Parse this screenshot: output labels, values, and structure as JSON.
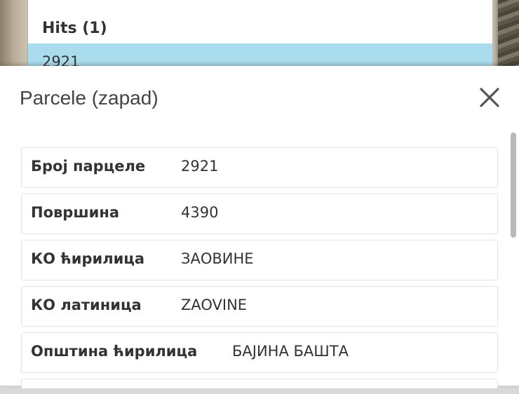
{
  "hits": {
    "title": "Hits (1)",
    "rows": [
      {
        "label": "2921"
      }
    ]
  },
  "panel": {
    "title": "Parcele (zapad)",
    "close_icon": "close-icon"
  },
  "attributes": [
    {
      "label": "Број парцеле",
      "value": "2921"
    },
    {
      "label": "Површина",
      "value": "4390"
    },
    {
      "label": "КО ћирилица",
      "value": "ЗАОВИНЕ"
    },
    {
      "label": "КО латиница",
      "value": "ZAOVINE"
    },
    {
      "label": "Општина ћирилица",
      "value": "БАЈИНА БАШТА"
    }
  ],
  "colors": {
    "selected_row": "#a9dced",
    "text": "#333333",
    "border": "#e3e3e3"
  }
}
